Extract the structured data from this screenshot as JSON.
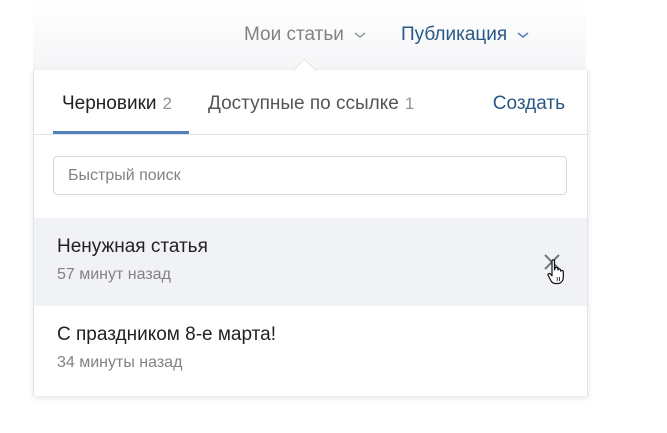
{
  "top_menu": {
    "my_articles": "Мои статьи",
    "publication": "Публикация"
  },
  "tabs": [
    {
      "label": "Черновики",
      "count": "2",
      "active": true
    },
    {
      "label": "Доступные по ссылке",
      "count": "1",
      "active": false
    }
  ],
  "create_label": "Создать",
  "search": {
    "placeholder": "Быстрый поиск",
    "value": ""
  },
  "articles": [
    {
      "title": "Ненужная статья",
      "time": "57 минут назад",
      "hovered": true
    },
    {
      "title": "С праздником 8-е марта!",
      "time": "34 минуты назад",
      "hovered": false
    }
  ],
  "colors": {
    "accent_link": "#2a5885",
    "tab_underline": "#5181b8",
    "hover_row": "#f0f2f5",
    "muted_text": "#828282"
  },
  "icons": [
    "chevron-down-icon",
    "close-icon",
    "hand-pointer-icon"
  ]
}
